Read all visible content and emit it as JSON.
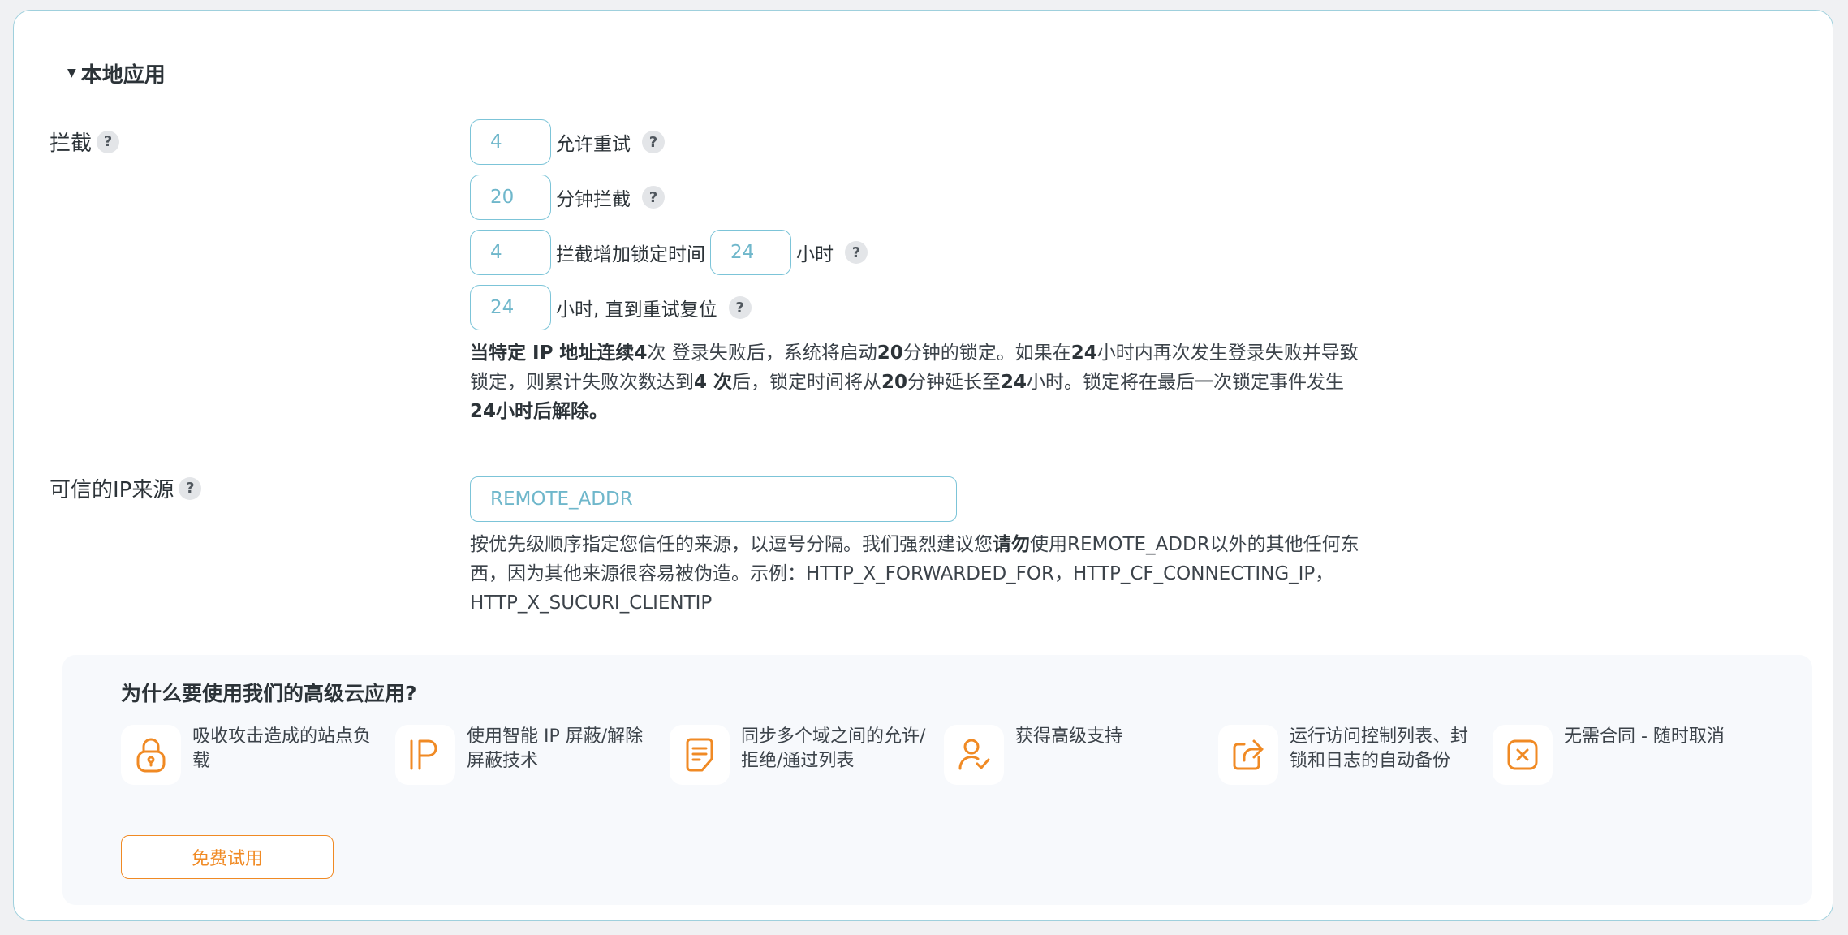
{
  "section": {
    "title": "本地应用"
  },
  "lockout": {
    "label": "拦截",
    "allowed_retries": "4",
    "allowed_retries_label": "允许重试",
    "lockout_minutes": "20",
    "lockout_minutes_label": "分钟拦截",
    "max_lockouts": "4",
    "max_lockouts_label": "拦截增加锁定时间",
    "long_duration": "24",
    "long_duration_unit": "小时",
    "valid_duration": "24",
    "valid_duration_label": "小时, 直到重试复位",
    "desc": {
      "p1": "当特定 IP 地址连续",
      "n1": "4",
      "p2": "次",
      "p3": " 登录失败后，系统将启动",
      "n2": "20",
      "p4": "分钟的锁定。如果在",
      "n3": "24",
      "p5": "小时内再次发生登录失败并导致锁定，则累计失败次数达到",
      "n4": "4 次",
      "p6": "后，锁定时间将从",
      "n5": "20",
      "p7": "分钟延长至",
      "n6": "24",
      "p8": "小时。锁定将在最后一次锁定事件发生",
      "n7": " 24小时后解除。"
    }
  },
  "trusted_ip": {
    "label": "可信的IP来源",
    "value": "REMOTE_ADDR",
    "desc_1": "按优先级顺序指定您信任的来源，以逗号分隔。我们强烈建议您",
    "desc_bold": "请勿",
    "desc_2": "使用REMOTE_ADDR以外的其他任何东西，因为其他来源很容易被伪造。示例：HTTP_X_FORWARDED_FOR，HTTP_CF_CONNECTING_IP，HTTP_X_SUCURI_CLIENTIP"
  },
  "promo": {
    "title": "为什么要使用我们的高级云应用?",
    "features": [
      {
        "icon": "lock-icon",
        "text": "吸收攻击造成的站点负载"
      },
      {
        "icon": "ip-icon",
        "text": "使用智能 IP 屏蔽/解除屏蔽技术"
      },
      {
        "icon": "document-icon",
        "text": "同步多个域之间的允许/拒绝/通过列表"
      },
      {
        "icon": "user-support-icon",
        "text": "获得高级支持"
      },
      {
        "icon": "share-export-icon",
        "text": "运行访问控制列表、封锁和日志的自动备份"
      },
      {
        "icon": "cancel-icon",
        "text": "无需合同 - 随时取消"
      }
    ],
    "button": "免费试用"
  },
  "help_mark": "?",
  "colors": {
    "accent": "#f08a24",
    "input_border": "#7cc4d8",
    "panel_border": "#9fd0dd"
  }
}
